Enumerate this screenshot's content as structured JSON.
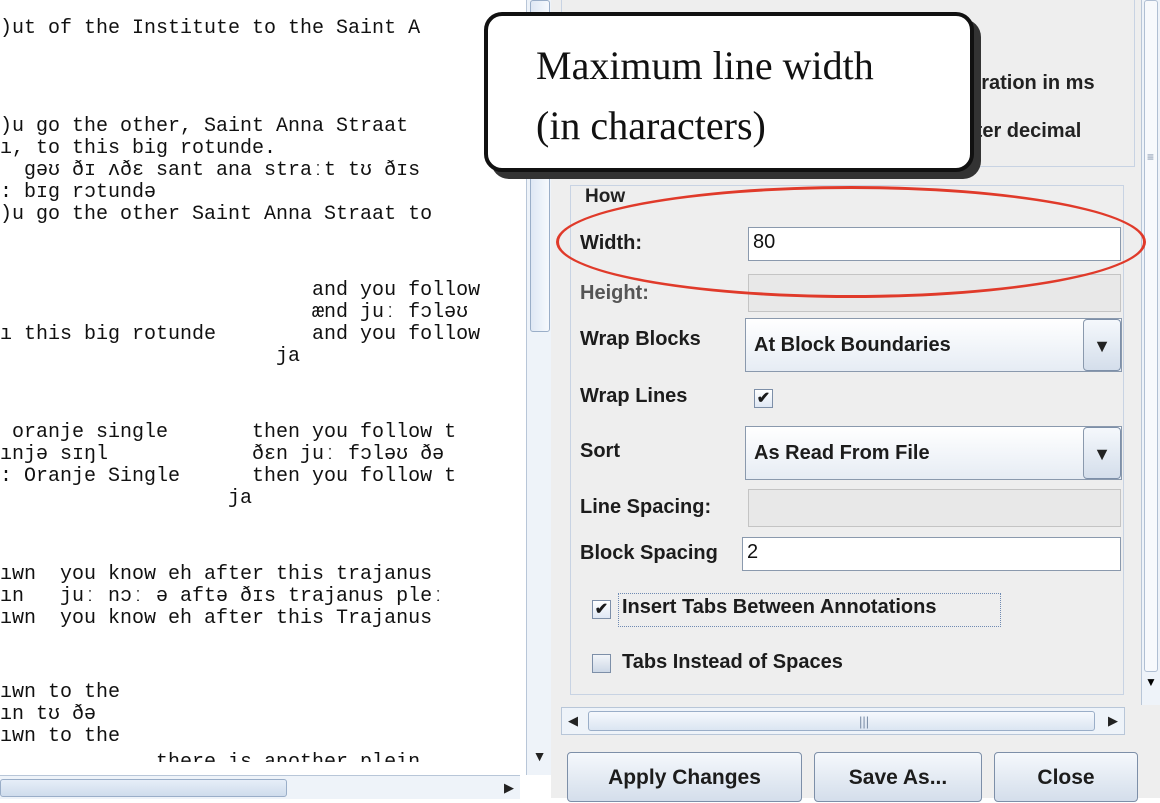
{
  "preview": {
    "lines": [
      ")ut of the Institute to the Saint A",
      ")u go the other, Saint Anna Straat",
      "ı, to this big rotunde.",
      "  gəʊ ðɪ ʌðɛ sant ana straːt tʊ ðɪs",
      ": bɪg rɔtundə",
      ")u go the other Saint Anna Straat to",
      "                          and you follow",
      "                          ænd juː fɔləʊ",
      "ı this big rotunde        and you follow",
      "                       ja",
      " oranje single       then you follow t",
      "ınjə sɪŋl            ðɛn juː fɔləʊ ðə",
      ": Oranje Single      then you follow t",
      "                   ja",
      "ıwn  you know eh after this trajanus",
      "ın   juː nɔː ə aftə ðɪs trajanus pleː",
      "ıwn  you know eh after this Trajanus",
      "ıwn to the",
      "ın tʊ ðə",
      "ıwn to the",
      "             there is another plein"
    ]
  },
  "options": {
    "top_label_1": "uration in ms",
    "top_label_2": "fter decimal",
    "how_legend": "How",
    "width_label": "Width:",
    "width_value": "80",
    "height_label": "Height:",
    "height_value": "",
    "wrap_blocks_label": "Wrap Blocks",
    "wrap_blocks_value": "At Block Boundaries",
    "wrap_lines_label": "Wrap Lines",
    "wrap_lines_checked": true,
    "sort_label": "Sort",
    "sort_value": "As Read From File",
    "line_spacing_label": "Line Spacing:",
    "line_spacing_value": "",
    "block_spacing_label": "Block Spacing",
    "block_spacing_value": "2",
    "insert_tabs_label": "Insert Tabs Between Annotations",
    "insert_tabs_checked": true,
    "tabs_instead_label": "Tabs Instead of Spaces",
    "tabs_instead_checked": false
  },
  "buttons": {
    "apply": "Apply Changes",
    "save_as": "Save As...",
    "close": "Close"
  },
  "annotation": {
    "callout_text": "Maximum line width\n(in characters)",
    "highlight_color": "#e03a2a"
  },
  "glyphs": {
    "check": "✔",
    "down": "▼",
    "left": "◀",
    "right": "▶",
    "grip_v": "≡",
    "grip_h": "|||"
  }
}
